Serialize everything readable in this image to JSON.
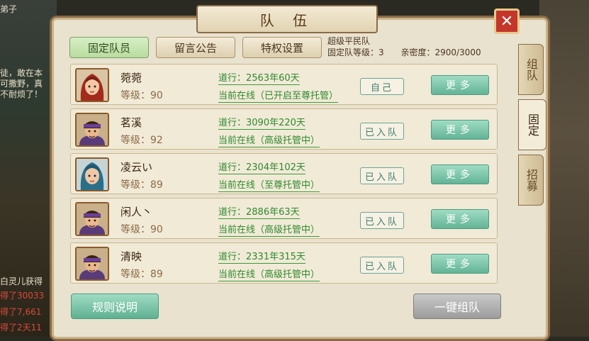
{
  "window": {
    "title": "队 伍",
    "close_symbol": "✕"
  },
  "tabs": [
    {
      "label": "固定队员",
      "active": true
    },
    {
      "label": "留言公告",
      "active": false
    },
    {
      "label": "特权设置",
      "active": false
    }
  ],
  "team_info": {
    "name": "超级平民队",
    "level": "固定队等级：3",
    "intimacy": "亲密度：2900/3000"
  },
  "side_tabs": [
    {
      "label": "组队",
      "active": false
    },
    {
      "label": "固定",
      "active": true
    },
    {
      "label": "招募",
      "active": false
    }
  ],
  "members": [
    {
      "name": "菀菀",
      "level": "等级：90",
      "dao": "道行：2563年60天",
      "status": "当前在线（已开启至尊托管）",
      "badge": "自己",
      "more": "更多",
      "avatar": "female-red"
    },
    {
      "name": "茗溪",
      "level": "等级：92",
      "dao": "道行：3090年220天",
      "status": "当前在线（高级托管中）",
      "badge": "已入队",
      "more": "更多",
      "avatar": "male-purple"
    },
    {
      "name": "凌云い",
      "level": "等级：89",
      "dao": "道行：2304年102天",
      "status": "当前在线（至尊托管中）",
      "badge": "已入队",
      "more": "更多",
      "avatar": "female-blue"
    },
    {
      "name": "闲人丶",
      "level": "等级：90",
      "dao": "道行：2886年63天",
      "status": "当前在线（高级托管中）",
      "badge": "已入队",
      "more": "更多",
      "avatar": "male-purple"
    },
    {
      "name": "清映",
      "level": "等级：89",
      "dao": "道行：2331年315天",
      "status": "当前在线（高级托管中）",
      "badge": "已入队",
      "more": "更多",
      "avatar": "male-purple"
    }
  ],
  "buttons": {
    "rules": "规则说明",
    "form_team": "一键组队"
  },
  "background_chat": {
    "lines": [
      {
        "text": "弟子",
        "color": "white"
      },
      {
        "text": "徒，敢在本",
        "color": "white"
      },
      {
        "text": "可撒野，真",
        "color": "white"
      },
      {
        "text": "不耐烦了！",
        "color": "white"
      },
      {
        "text": "白灵儿获得",
        "color": "white"
      },
      {
        "text": "得了30033",
        "color": "red"
      },
      {
        "text": "得了7,661",
        "color": "red"
      },
      {
        "text": "得了2天11",
        "color": "red"
      }
    ]
  },
  "colors": {
    "accent_green": "#2e8a2e",
    "close_red": "#c4362a",
    "frame_brown": "#8a6a44"
  }
}
